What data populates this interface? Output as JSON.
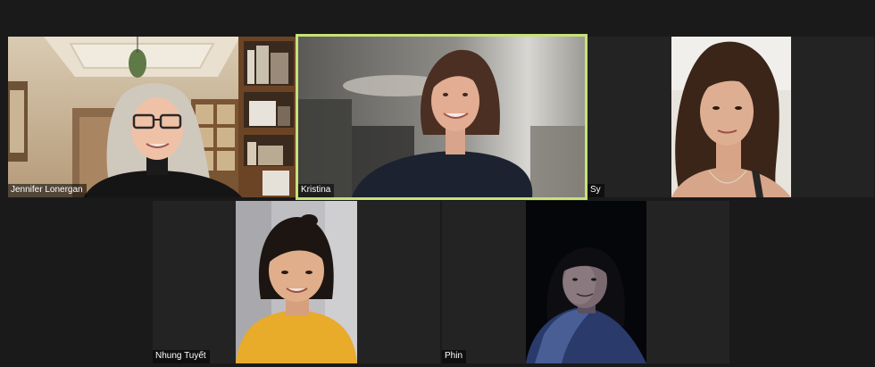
{
  "meeting": {
    "participants": [
      {
        "name": "Jennifer Lonergan"
      },
      {
        "name": "Kristina"
      },
      {
        "name": "Sy"
      },
      {
        "name": "Nhung Tuyết"
      },
      {
        "name": "Phin"
      }
    ],
    "active_speaker_color": "#c6e27a",
    "background_color": "#1a1a1a",
    "tile_color": "#232323"
  }
}
